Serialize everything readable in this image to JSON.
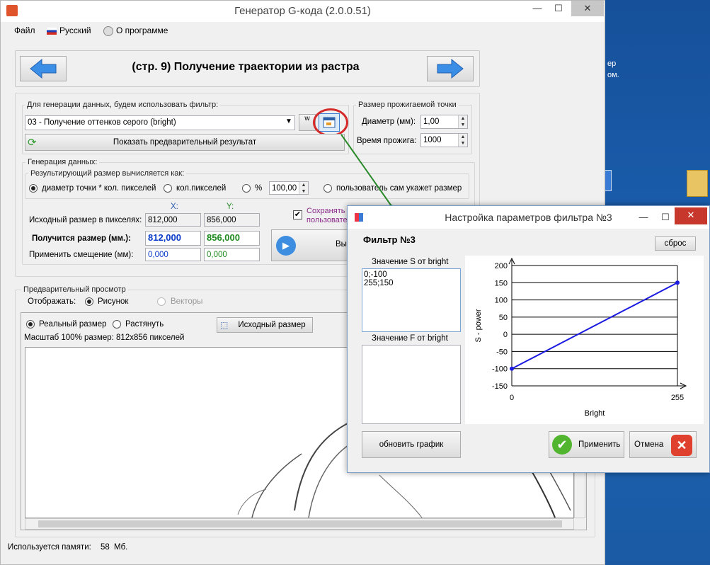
{
  "window": {
    "title": "Генератор G-кода (2.0.0.51)",
    "min": "—",
    "max": "☐",
    "close": "✕"
  },
  "menu": {
    "file": "Файл",
    "language": "Русский",
    "about": "О программе"
  },
  "page": {
    "title": "(стр. 9) Получение траектории из растра"
  },
  "filter": {
    "group_label": "Для генерации данных, будем использовать фильтр:",
    "selected": "03 - Получение оттенков серого (bright)",
    "preview_button": "Показать предварительный результат"
  },
  "point": {
    "group_label": "Размер прожигаемой точки",
    "diameter_label": "Диаметр (мм):",
    "diameter_value": "1,00",
    "burn_label": "Время прожига:",
    "burn_value": "1000"
  },
  "gen": {
    "group_label": "Генерация данных:",
    "sub_label": "Результирующий размер вычисляется как:",
    "opt1": "диаметр точки * кол. пикселей",
    "opt2": "кол.пикселей",
    "opt3": "%",
    "percent": "100,00",
    "opt4": "пользователь сам укажет размер",
    "x_header": "X:",
    "y_header": "Y:",
    "src_label": "Исходный размер в пикселях:",
    "src_x": "812,000",
    "src_y": "856,000",
    "res_label": "Получится размер (мм.):",
    "res_x": "812,000",
    "res_y": "856,000",
    "offset_label": "Применить смещение (мм):",
    "off_x": "0,000",
    "off_y": "0,000",
    "save_label1": "Сохранять п",
    "save_label2": "пользовате",
    "run_button": "Вы"
  },
  "preview": {
    "group_label": "Предварительный просмотр",
    "show_label": "Отображать:",
    "pic": "Рисунок",
    "vectors": "Векторы",
    "real": "Реальный размер",
    "stretch": "Растянуть",
    "orig_button": "Исходный размер",
    "scale_text": "Масштаб 100% размер: 812x856 пикселей"
  },
  "status": {
    "memory_label": "Используется памяти:",
    "memory_value": "58",
    "memory_unit": "Мб."
  },
  "dialog": {
    "title": "Настройка параметров фильтра №3",
    "heading": "Фильтр №3",
    "reset": "сброс",
    "s_label": "Значение S от bright",
    "s_value": "0;-100\n255;150",
    "f_label": "Значение F от bright",
    "f_value": "",
    "update": "обновить график",
    "apply": "Применить",
    "cancel": "Отмена"
  },
  "desktop": {
    "label1": "ер",
    "label2": "ом."
  },
  "colors": {
    "accent_blue": "#0a3ac8",
    "green": "#1f8a1f",
    "red_circle": "#d42a2a",
    "arrow": "#2a8a2a"
  },
  "chart_data": {
    "type": "line",
    "xlabel": "Bright",
    "ylabel": "S - power",
    "x_ticks": [
      "0",
      "255"
    ],
    "y_ticks": [
      "200",
      "150",
      "100",
      "50",
      "0",
      "-50",
      "-100",
      "-150"
    ],
    "xlim": [
      0,
      255
    ],
    "ylim": [
      -150,
      200
    ],
    "grid": true,
    "series": [
      {
        "x": [
          0,
          255
        ],
        "y": [
          -100,
          150
        ]
      }
    ]
  }
}
